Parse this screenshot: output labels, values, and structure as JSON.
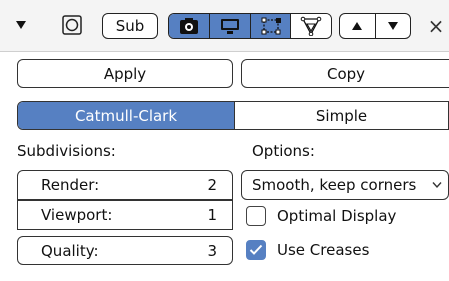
{
  "header": {
    "collapse_icon": "triangle-down-icon",
    "toggle_icon": "ring-icon",
    "modifier_name": "Sub",
    "visibility_icons": [
      "camera-icon",
      "monitor-icon",
      "editmode-vertices-icon",
      "cage-icon"
    ],
    "move_up_icon": "triangle-up-icon",
    "move_down_icon": "triangle-down-icon",
    "close_glyph": "×"
  },
  "actions": {
    "apply_label": "Apply",
    "copy_label": "Copy"
  },
  "type_tabs": {
    "catmull_clark": "Catmull-Clark",
    "simple": "Simple",
    "active": "Catmull-Clark"
  },
  "subdivisions": {
    "heading": "Subdivisions:",
    "render_label": "Render:",
    "render_value": "2",
    "viewport_label": "Viewport:",
    "viewport_value": "1",
    "quality_label": "Quality:",
    "quality_value": "3"
  },
  "options": {
    "heading": "Options:",
    "uv_smooth_value": "Smooth, keep corners",
    "optimal_display_label": "Optimal Display",
    "optimal_display_checked": false,
    "use_creases_label": "Use Creases",
    "use_creases_checked": true
  },
  "colors": {
    "accent": "#5680c2",
    "header_bg": "#f4f4f4",
    "border": "#333333"
  }
}
